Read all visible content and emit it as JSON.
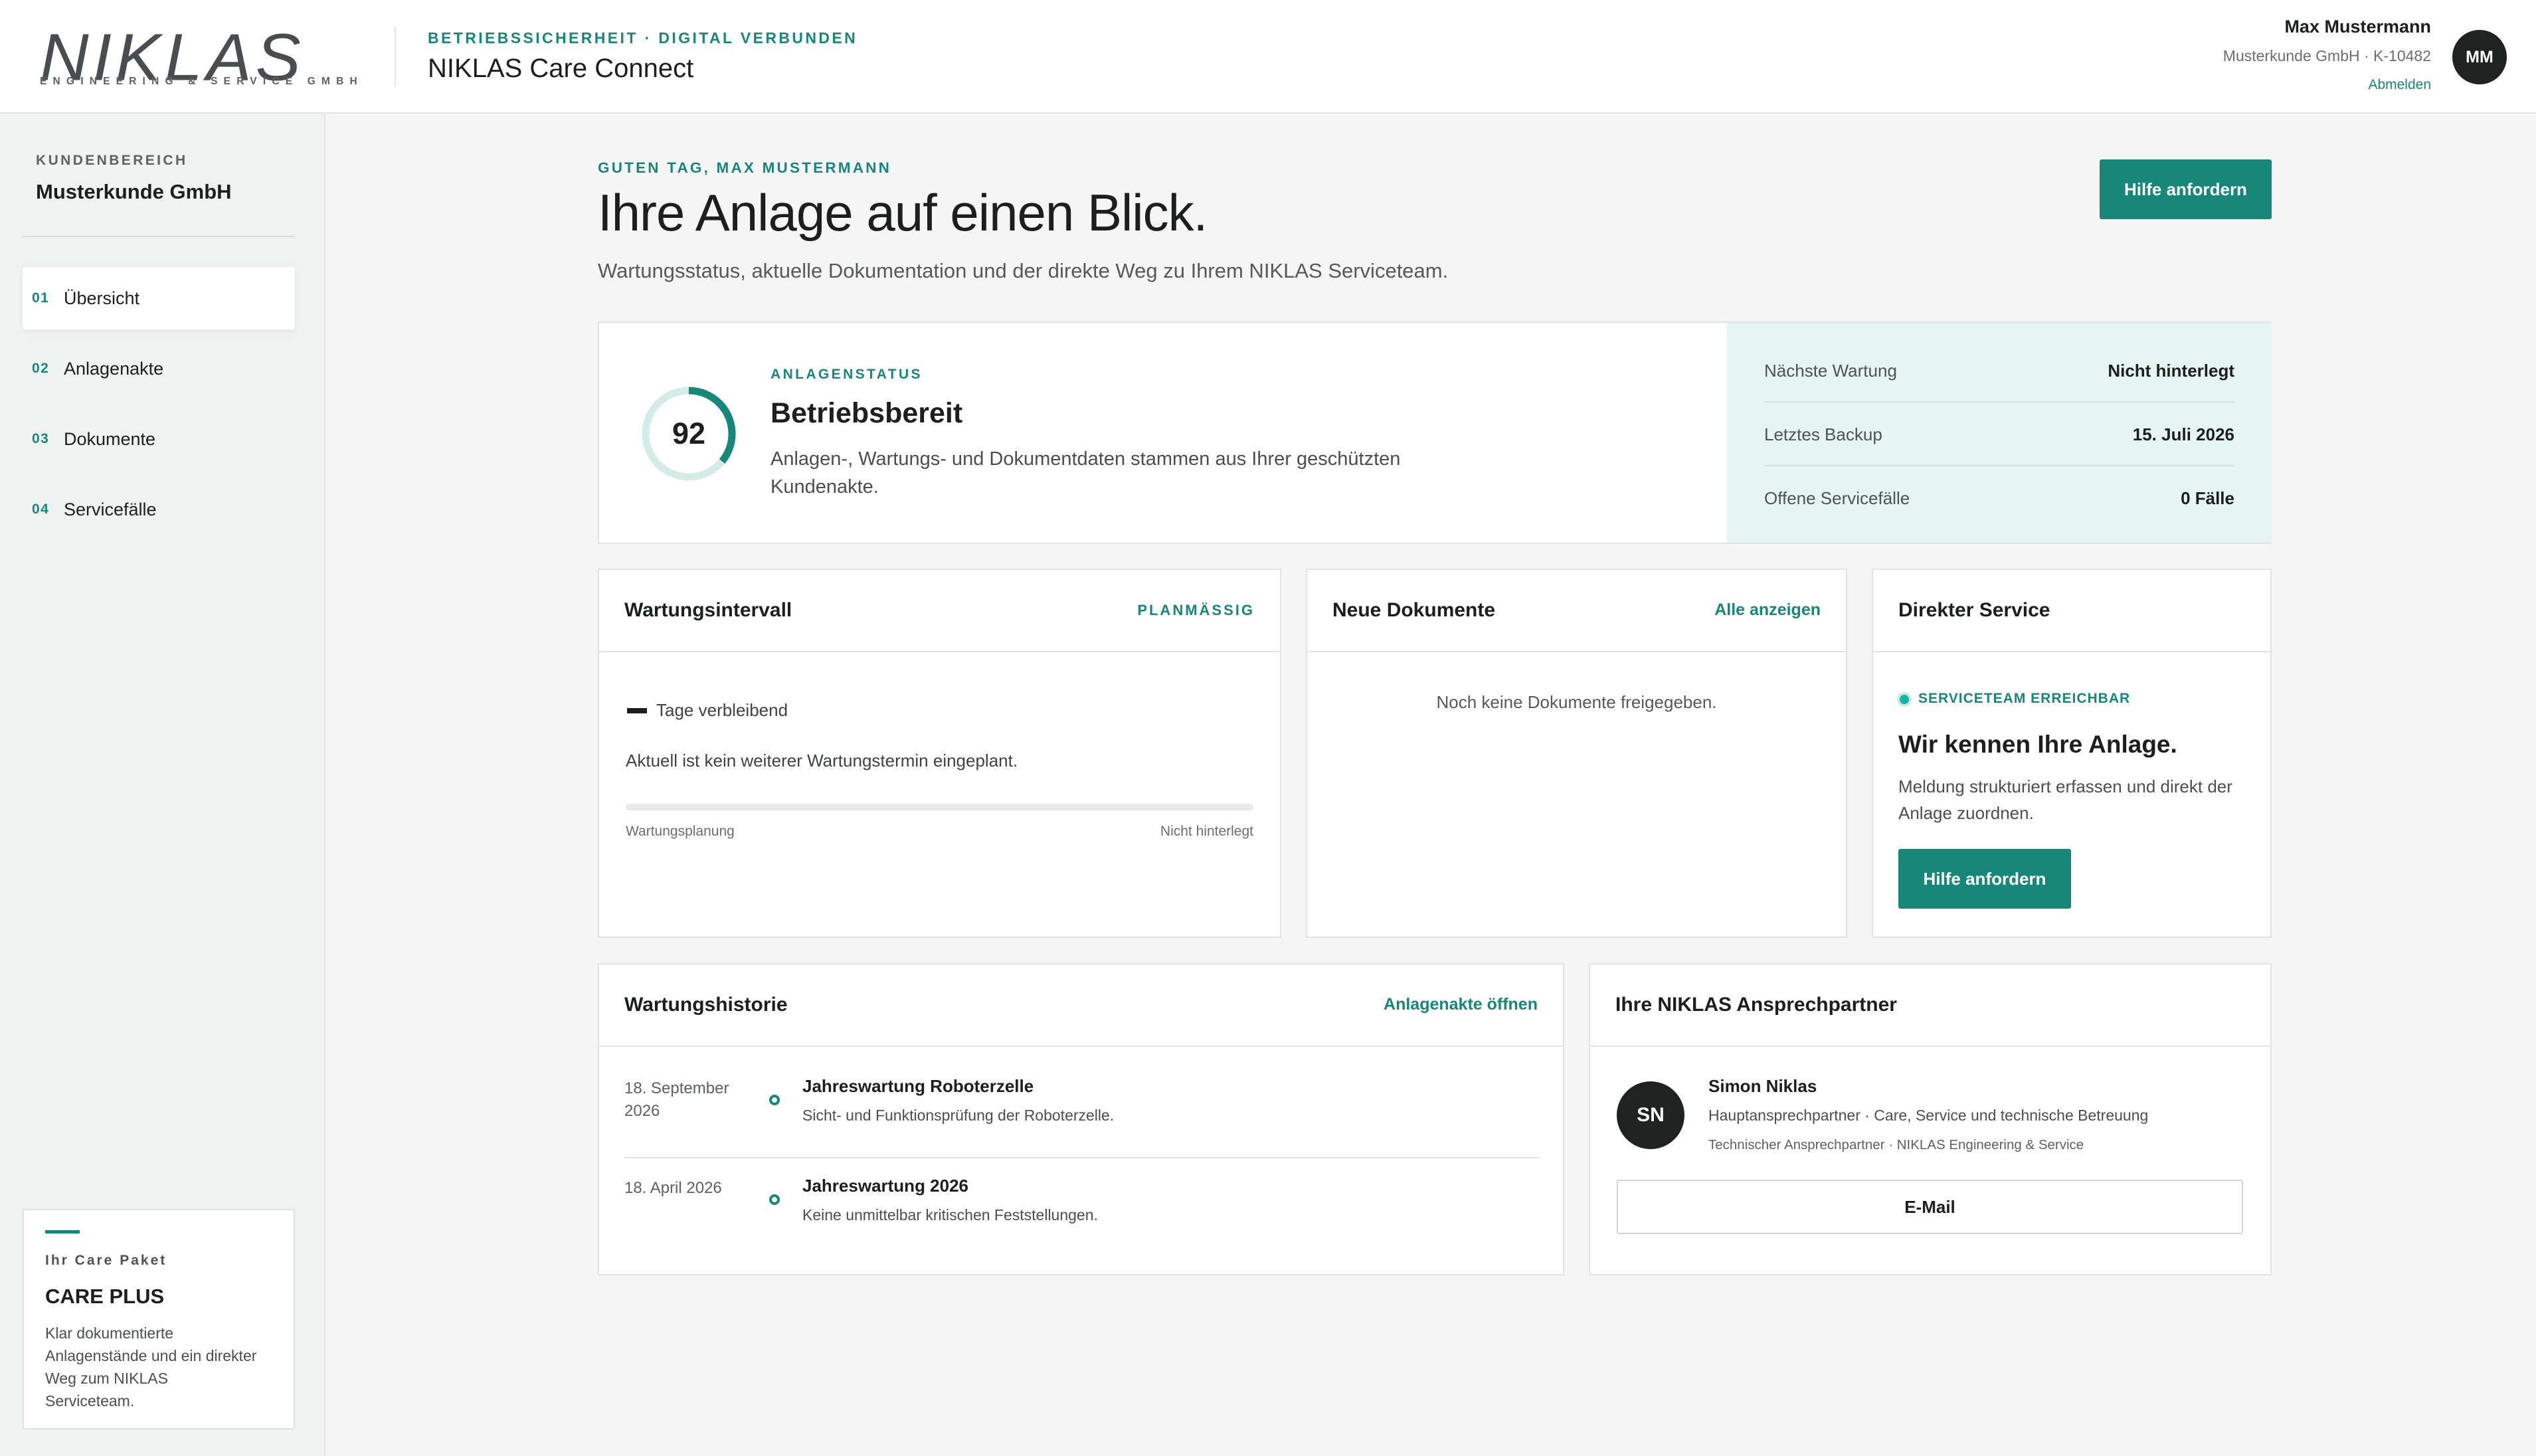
{
  "header": {
    "logo_text": "NIKLAS",
    "logo_subtext": "ENGINEERING & SERVICE GMBH",
    "kicker": "BETRIEBSSICHERHEIT · DIGITAL VERBUNDEN",
    "app_title": "NIKLAS Care Connect",
    "user_name": "Max Mustermann",
    "user_sub": "Musterkunde GmbH · K-10482",
    "logout_label": "Abmelden",
    "avatar_initials": "MM"
  },
  "sidebar": {
    "kicker": "KUNDENBEREICH",
    "company": "Musterkunde GmbH",
    "items": [
      {
        "num": "01",
        "label": "Übersicht",
        "active": true
      },
      {
        "num": "02",
        "label": "Anlagenakte",
        "active": false
      },
      {
        "num": "03",
        "label": "Dokumente",
        "active": false
      },
      {
        "num": "04",
        "label": "Servicefälle",
        "active": false
      }
    ],
    "care": {
      "kicker": "Ihr Care Paket",
      "title": "CARE PLUS",
      "text": "Klar dokumentierte Anlagenstände und ein direkter Weg zum NIKLAS Serviceteam."
    }
  },
  "main": {
    "greeting": "GUTEN TAG, MAX MUSTERMANN",
    "title": "Ihre Anlage auf einen Blick.",
    "subtitle": "Wartungsstatus, aktuelle Dokumentation und der direkte Weg zu Ihrem NIKLAS Serviceteam.",
    "help_button": "Hilfe anfordern"
  },
  "status": {
    "score": 92,
    "kicker": "ANLAGENSTATUS",
    "title": "Betriebsbereit",
    "text": "Anlagen-, Wartungs- und Dokumentdaten stammen aus Ihrer geschützten Kundenakte.",
    "facts": [
      {
        "key": "Nächste Wartung",
        "value": "Nicht hinterlegt"
      },
      {
        "key": "Letztes Backup",
        "value": "15. Juli 2026"
      },
      {
        "key": "Offene Servicefälle",
        "value": "0 Fälle"
      }
    ],
    "colors": {
      "accent": "#17877a",
      "track": "#d4ece8"
    }
  },
  "maintenance": {
    "title": "Wartungsintervall",
    "badge": "PLANMÄSSIG",
    "days_label": "Tage verbleibend",
    "text": "Aktuell ist kein weiterer Wartungstermin eingeplant.",
    "progress": 0,
    "left_label": "Wartungsplanung",
    "right_label": "Nicht hinterlegt"
  },
  "documents": {
    "title": "Neue Dokumente",
    "link": "Alle anzeigen",
    "empty": "Noch keine Dokumente freigegeben."
  },
  "service": {
    "title": "Direkter Service",
    "status": "SERVICETEAM ERREICHBAR",
    "heading": "Wir kennen Ihre Anlage.",
    "text": "Meldung strukturiert erfassen und direkt der Anlage zuordnen.",
    "button": "Hilfe anfordern"
  },
  "history": {
    "title": "Wartungshistorie",
    "link": "Anlagenakte öffnen",
    "entries": [
      {
        "date": "18. September 2026",
        "title": "Jahreswartung Roboterzelle",
        "text": "Sicht- und Funktionsprüfung der Roboterzelle."
      },
      {
        "date": "18. April 2026",
        "title": "Jahreswartung 2026",
        "text": "Keine unmittelbar kritischen Feststellungen."
      }
    ]
  },
  "contact": {
    "title": "Ihre NIKLAS Ansprechpartner",
    "initials": "SN",
    "name": "Simon Niklas",
    "role": "Hauptansprechpartner · Care, Service und technische Betreuung",
    "org": "Technischer Ansprechpartner · NIKLAS Engineering & Service",
    "mail_button": "E-Mail"
  }
}
